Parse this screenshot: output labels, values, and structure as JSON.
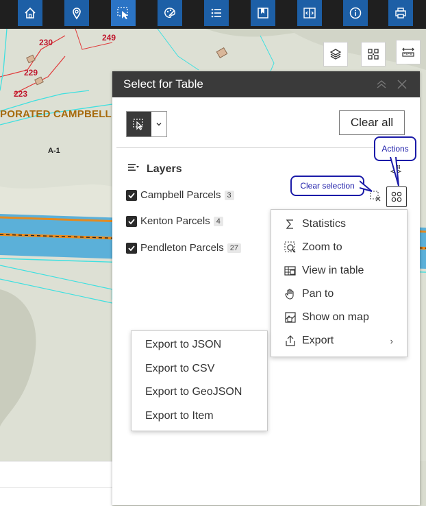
{
  "toolbar": {
    "buttons": [
      {
        "name": "home-icon"
      },
      {
        "name": "location-pin-icon"
      },
      {
        "name": "select-icon"
      },
      {
        "name": "palette-icon"
      },
      {
        "name": "list-icon"
      },
      {
        "name": "bookmark-icon"
      },
      {
        "name": "swipe-icon"
      },
      {
        "name": "info-icon"
      },
      {
        "name": "print-icon"
      }
    ],
    "accent": "#1d5fa6",
    "active_accent": "#2b74c5"
  },
  "map": {
    "parcel_labels": [
      "230",
      "249",
      "229",
      "223"
    ],
    "place_label": "PORATED CAMPBELL",
    "zone_label": "A-1"
  },
  "map_tools": {
    "layers_icon": "layers-icon",
    "qr_icon": "qr-grid-icon",
    "measure_icon": "measure-icon"
  },
  "panel": {
    "title": "Select for Table",
    "clear_all": "Clear all",
    "layers_title": "Layers",
    "layers": [
      {
        "name": "Campbell Parcels",
        "count": "3"
      },
      {
        "name": "Kenton Parcels",
        "count": "4"
      },
      {
        "name": "Pendleton Parcels",
        "count": "27"
      }
    ]
  },
  "callouts": {
    "actions": "Actions",
    "clear_selection": "Clear selection"
  },
  "actions_menu": {
    "items": [
      {
        "label": "Statistics",
        "icon": "sigma-icon"
      },
      {
        "label": "Zoom to",
        "icon": "zoom-to-icon"
      },
      {
        "label": "View in table",
        "icon": "table-icon"
      },
      {
        "label": "Pan to",
        "icon": "hand-icon"
      },
      {
        "label": "Show on map",
        "icon": "map-show-icon"
      },
      {
        "label": "Export",
        "icon": "export-icon"
      }
    ]
  },
  "export_menu": {
    "items": [
      "Export to JSON",
      "Export to CSV",
      "Export to GeoJSON",
      "Export to Item"
    ]
  },
  "colors": {
    "panel_header": "#3a3a3a",
    "callout_border": "#1a1aa8",
    "parcel_line": "#3ee0e0",
    "parcel_boundary": "#e03a3a"
  }
}
